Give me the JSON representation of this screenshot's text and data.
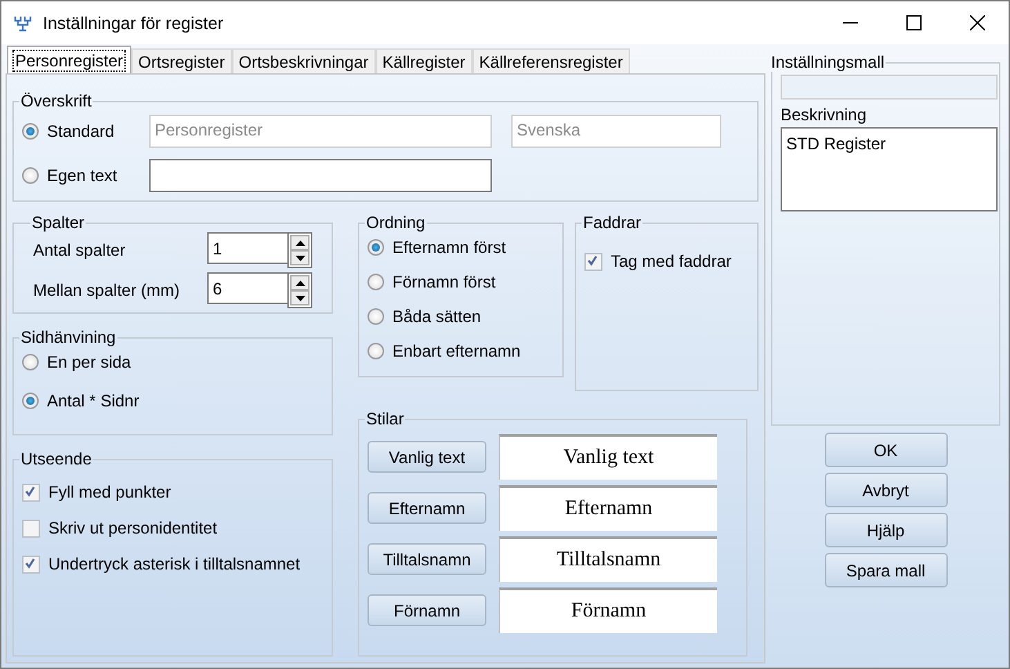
{
  "window": {
    "title": "Inställningar för register"
  },
  "tabs": [
    {
      "label": "Personregister",
      "selected": true
    },
    {
      "label": "Ortsregister",
      "selected": false
    },
    {
      "label": "Ortsbeskrivningar",
      "selected": false
    },
    {
      "label": "Källregister",
      "selected": false
    },
    {
      "label": "Källreferensregister",
      "selected": false
    }
  ],
  "heading": {
    "title": "Överskrift",
    "options": [
      {
        "label": "Standard",
        "selected": true
      },
      {
        "label": "Egen text",
        "selected": false
      }
    ],
    "standard_field": {
      "value": "Personregister",
      "disabled": true
    },
    "language_field": {
      "value": "Svenska",
      "disabled": true
    },
    "custom_field": {
      "disabled": false
    }
  },
  "columns": {
    "title": "Spalter",
    "spinners": [
      {
        "label": "Antal spalter",
        "value": "1"
      },
      {
        "label": "Mellan spalter (mm)",
        "value": "6"
      }
    ]
  },
  "page_reference": {
    "title": "Sidhänvining",
    "options": [
      {
        "label": "En per sida",
        "selected": false
      },
      {
        "label": "Antal * Sidnr",
        "selected": true
      }
    ]
  },
  "appearance": {
    "title": "Utseende",
    "checkboxes": [
      {
        "label": "Fyll med punkter",
        "checked": true
      },
      {
        "label": "Skriv ut personidentitet",
        "checked": false
      },
      {
        "label": "Undertryck asterisk i tilltalsnamnet",
        "checked": true
      }
    ]
  },
  "order": {
    "title": "Ordning",
    "options": [
      {
        "label": "Efternamn först",
        "selected": true
      },
      {
        "label": "Förnamn först",
        "selected": false
      },
      {
        "label": "Båda sätten",
        "selected": false
      },
      {
        "label": "Enbart efternamn",
        "selected": false
      }
    ]
  },
  "godparents": {
    "title": "Faddrar",
    "checkboxes": [
      {
        "label": "Tag med faddrar",
        "checked": true
      }
    ]
  },
  "styles": {
    "title": "Stilar",
    "rows": [
      {
        "button": "Vanlig text",
        "sample": "Vanlig text"
      },
      {
        "button": "Efternamn",
        "sample": "Efternamn"
      },
      {
        "button": "Tilltalsnamn",
        "sample": "Tilltalsnamn"
      },
      {
        "button": "Förnamn",
        "sample": "Förnamn"
      }
    ]
  },
  "template": {
    "title": "Inställningsmall",
    "field": {
      "disabled": true
    },
    "description_label": "Beskrivning",
    "description": "STD Register"
  },
  "buttons": [
    "OK",
    "Avbryt",
    "Hjälp",
    "Spara mall"
  ]
}
